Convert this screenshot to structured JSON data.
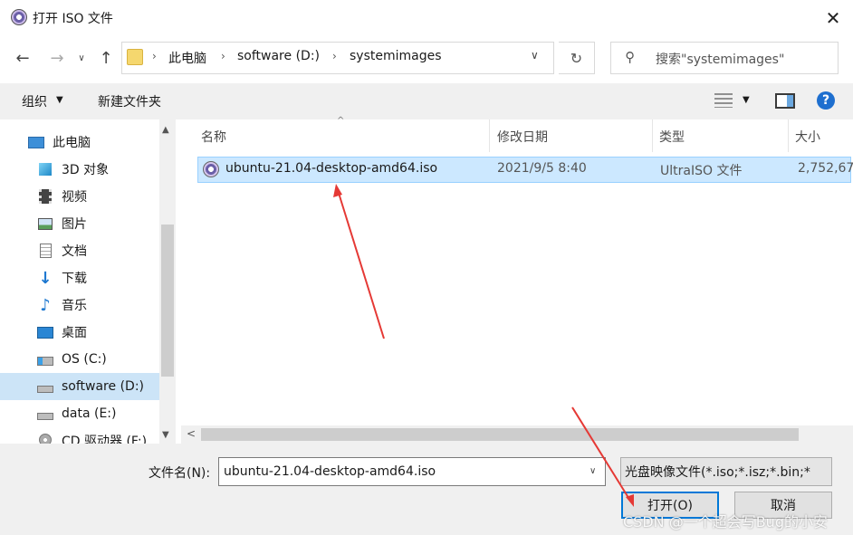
{
  "window": {
    "title": "打开 ISO 文件",
    "close_glyph": "✕"
  },
  "address": {
    "crumbs": [
      "此电脑",
      "software (D:)",
      "systemimages"
    ]
  },
  "search": {
    "placeholder": "搜索\"systemimages\""
  },
  "toolbar": {
    "organize_label": "组织",
    "new_folder_label": "新建文件夹",
    "help_label": "?"
  },
  "nav": {
    "items": [
      {
        "label": "此电脑",
        "icon": "monitor-icon"
      },
      {
        "label": "3D 对象",
        "icon": "cube-icon"
      },
      {
        "label": "视频",
        "icon": "film-icon"
      },
      {
        "label": "图片",
        "icon": "picture-icon"
      },
      {
        "label": "文档",
        "icon": "document-icon"
      },
      {
        "label": "下载",
        "icon": "download-arrow-icon"
      },
      {
        "label": "音乐",
        "icon": "music-note-icon"
      },
      {
        "label": "桌面",
        "icon": "desktop-icon"
      },
      {
        "label": "OS (C:)",
        "icon": "windows-drive-icon"
      },
      {
        "label": "software (D:)",
        "icon": "drive-icon",
        "selected": true
      },
      {
        "label": "data (E:)",
        "icon": "drive-icon"
      },
      {
        "label": "CD 驱动器 (F:)",
        "icon": "cd-drive-icon"
      }
    ]
  },
  "columns": {
    "name": "名称",
    "date": "修改日期",
    "type": "类型",
    "size": "大小"
  },
  "files": [
    {
      "name": "ubuntu-21.04-desktop-amd64.iso",
      "date": "2021/9/5 8:40",
      "type": "UltraISO 文件",
      "size": "2,752,67",
      "icon": "disc-icon",
      "selected": true
    }
  ],
  "bottom": {
    "filename_label": "文件名(N):",
    "filename_value": "ubuntu-21.04-desktop-amd64.iso",
    "filetype_value": "光盘映像文件(*.iso;*.isz;*.bin;*",
    "open_label": "打开(O)",
    "cancel_label": "取消"
  },
  "watermark": "CSDN @一个超会写Bug的小安",
  "colors": {
    "selection": "#cce8ff",
    "nav_selection": "#cce4f7",
    "accent": "#0078d7",
    "annotation_arrow": "#e53935"
  }
}
